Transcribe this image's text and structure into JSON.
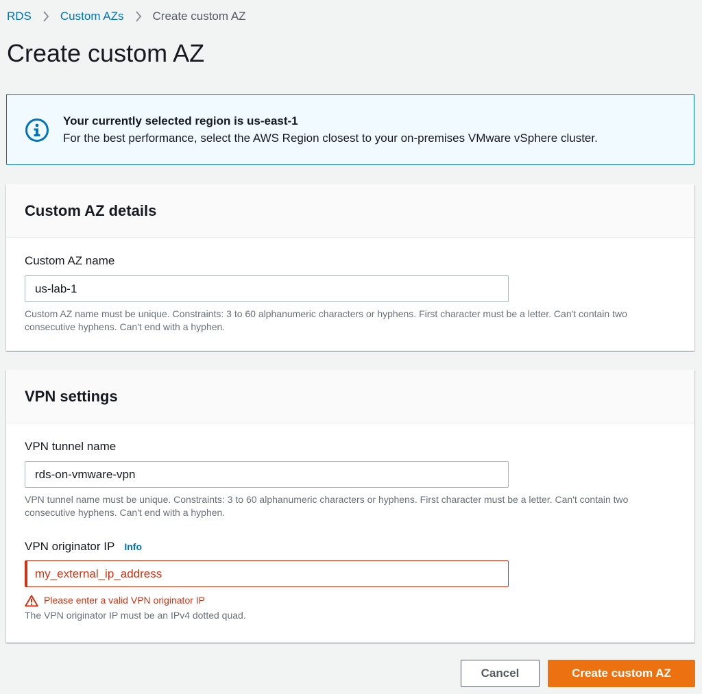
{
  "breadcrumb": {
    "items": [
      "RDS",
      "Custom AZs"
    ],
    "current": "Create custom AZ"
  },
  "page": {
    "title": "Create custom AZ"
  },
  "alert": {
    "icon": "info-circle-icon",
    "title": "Your currently selected region is us-east-1",
    "body": "For the best performance, select the AWS Region closest to your on-premises VMware vSphere cluster."
  },
  "details_panel": {
    "title": "Custom AZ details",
    "name_label": "Custom AZ name",
    "name_value": "us-lab-1",
    "name_hint": "Custom AZ name must be unique. Constraints: 3 to 60 alphanumeric characters or hyphens. First character must be a letter. Can't contain two consecutive hyphens. Can't end with a hyphen."
  },
  "vpn_panel": {
    "title": "VPN settings",
    "tunnel_label": "VPN tunnel name",
    "tunnel_value": "rds-on-vmware-vpn",
    "tunnel_hint": "VPN tunnel name must be unique. Constraints: 3 to 60 alphanumeric characters or hyphens. First character must be a letter. Can't contain two consecutive hyphens. Can't end with a hyphen.",
    "ip_label": "VPN originator IP",
    "ip_info": "Info",
    "ip_value": "my_external_ip_address",
    "ip_error": "Please enter a valid VPN originator IP",
    "ip_hint": "The VPN originator IP must be an IPv4 dotted quad."
  },
  "actions": {
    "cancel": "Cancel",
    "submit": "Create custom AZ"
  },
  "colors": {
    "link": "#0073bb",
    "primary": "#ec7211",
    "error": "#d13212",
    "alert_bg": "#f1faff"
  }
}
